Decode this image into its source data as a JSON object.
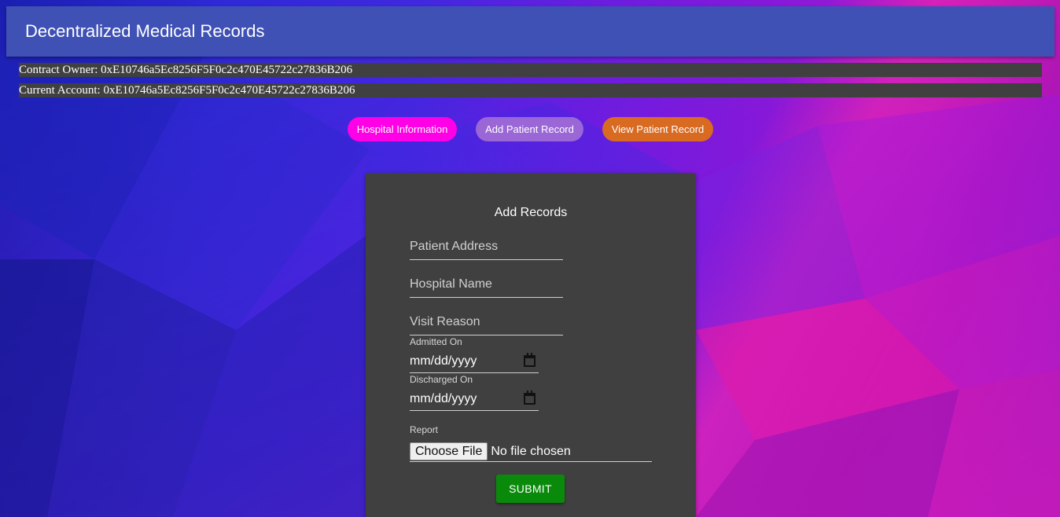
{
  "header": {
    "title": "Decentralized Medical Records"
  },
  "info": {
    "owner": "Contract Owner: 0xE10746a5Ec8256F5F0c2c470E45722c27836B206",
    "account": "Current Account: 0xE10746a5Ec8256F5F0c2c470E45722c27836B206"
  },
  "nav": {
    "hospital": "Hospital Information",
    "add": "Add Patient Record",
    "view": "View Patient Record"
  },
  "form": {
    "title": "Add Records",
    "patient_placeholder": "Patient Address",
    "hospital_placeholder": "Hospital Name",
    "visit_placeholder": "Visit Reason",
    "admitted_label": "Admitted On",
    "admitted_value": "mm/dd/yyyy",
    "discharged_label": "Discharged On",
    "discharged_value": "mm/dd/yyyy",
    "report_label": "Report",
    "file_button": "Choose File",
    "file_status": "No file chosen",
    "submit": "SUBMIT"
  },
  "colors": {
    "appbar": "#3f51b5",
    "hospital_pill": "#ff00e6",
    "add_pill": "#9b66d6",
    "view_pill": "#d86a22",
    "submit": "#0a8a0a",
    "card": "#404040"
  },
  "icons": {
    "date_picker": "calendar-icon"
  }
}
